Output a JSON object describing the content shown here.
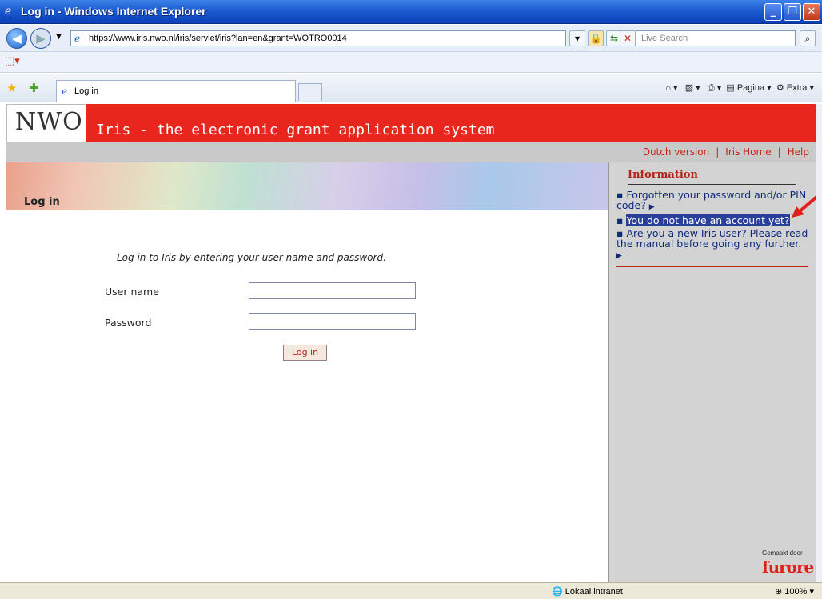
{
  "window": {
    "title": "Log in - Windows Internet Explorer"
  },
  "browser": {
    "address": "https://www.iris.nwo.nl/iris/servlet/iris?lan=en&grant=WOTRO0014",
    "search_placeholder": "Live Search",
    "tab_label": "Log in",
    "commands": {
      "page": "Pagina",
      "extra": "Extra"
    }
  },
  "page": {
    "logo": "NWO",
    "app_title": "Iris - the electronic grant application system",
    "top_links": [
      "Dutch version",
      "Iris Home",
      "Help"
    ],
    "heading": "Log in",
    "intro": "Log in to Iris by entering your user name and password.",
    "username_label": "User name",
    "password_label": "Password",
    "login_button": "Log in"
  },
  "sidebar": {
    "heading": "Information",
    "items": [
      "Forgotten your password and/or PIN code?",
      "You do not have an account yet?",
      "Are you a new Iris user? Please read the manual before going any further."
    ],
    "credit": "Gemaakt door",
    "brand": "furore"
  },
  "status": {
    "zone": "Lokaal intranet",
    "zoom": "100%"
  }
}
